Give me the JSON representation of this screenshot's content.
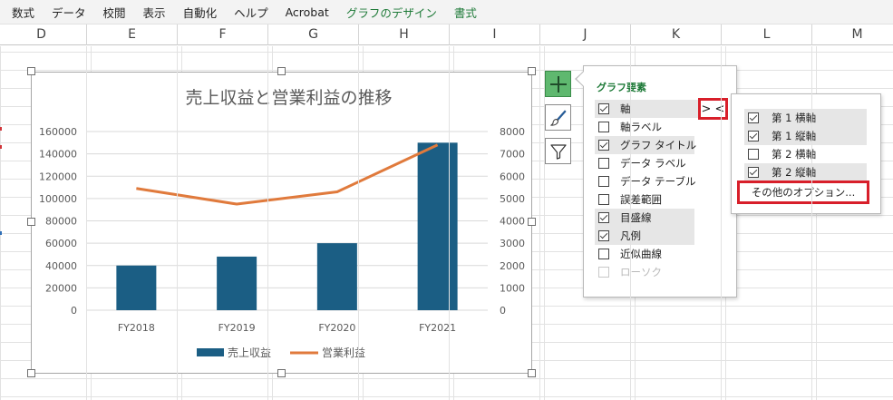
{
  "ribbon": {
    "tabs": [
      {
        "label": "数式",
        "accent": false
      },
      {
        "label": "データ",
        "accent": false
      },
      {
        "label": "校閲",
        "accent": false
      },
      {
        "label": "表示",
        "accent": false
      },
      {
        "label": "自動化",
        "accent": false
      },
      {
        "label": "ヘルプ",
        "accent": false
      },
      {
        "label": "Acrobat",
        "accent": false
      },
      {
        "label": "グラフのデザイン",
        "accent": true
      },
      {
        "label": "書式",
        "accent": true
      }
    ]
  },
  "columns": [
    "D",
    "E",
    "F",
    "G",
    "H",
    "I",
    "J",
    "K",
    "L",
    "M"
  ],
  "chart_data": {
    "type": "bar",
    "title": "売上収益と営業利益の推移",
    "categories": [
      "FY2018",
      "FY2019",
      "FY2020",
      "FY2021"
    ],
    "series": [
      {
        "name": "売上収益",
        "type": "bar",
        "axis": "left",
        "values": [
          40000,
          48000,
          60000,
          150000
        ],
        "color": "#1b5e84"
      },
      {
        "name": "営業利益",
        "type": "line",
        "axis": "right",
        "values": [
          5450,
          4750,
          5300,
          7400
        ],
        "color": "#e07a3c"
      }
    ],
    "y_left": {
      "min": 0,
      "max": 160000,
      "ticks": [
        "0",
        "20000",
        "40000",
        "60000",
        "80000",
        "100000",
        "120000",
        "140000",
        "160000"
      ]
    },
    "y_right": {
      "min": 0,
      "max": 8000,
      "ticks": [
        "0",
        "1000",
        "2000",
        "3000",
        "4000",
        "5000",
        "6000",
        "7000",
        "8000"
      ]
    },
    "grid": true,
    "legend": "bottom"
  },
  "chart_elements_panel": {
    "title": "グラフ要素",
    "items": [
      {
        "label": "軸",
        "checked": true,
        "highlighted": true,
        "disabled": false
      },
      {
        "label": "軸ラベル",
        "checked": false,
        "highlighted": false,
        "disabled": false
      },
      {
        "label": "グラフ タイトル",
        "checked": true,
        "highlighted": true,
        "disabled": false
      },
      {
        "label": "データ ラベル",
        "checked": false,
        "highlighted": false,
        "disabled": false
      },
      {
        "label": "データ テーブル",
        "checked": false,
        "highlighted": false,
        "disabled": false
      },
      {
        "label": "誤差範囲",
        "checked": false,
        "highlighted": false,
        "disabled": false
      },
      {
        "label": "目盛線",
        "checked": true,
        "highlighted": true,
        "disabled": false
      },
      {
        "label": "凡例",
        "checked": true,
        "highlighted": true,
        "disabled": false
      },
      {
        "label": "近似曲線",
        "checked": false,
        "highlighted": false,
        "disabled": false
      },
      {
        "label": "ローソク",
        "checked": false,
        "highlighted": false,
        "disabled": true
      }
    ],
    "expand_label": "> <"
  },
  "axis_submenu": {
    "items": [
      {
        "label": "第 1 横軸",
        "checked": true
      },
      {
        "label": "第 1 縦軸",
        "checked": true
      },
      {
        "label": "第 2 横軸",
        "checked": false
      },
      {
        "label": "第 2 縦軸",
        "checked": true
      }
    ],
    "more_options": "その他のオプション..."
  },
  "colors": {
    "accent_green": "#1e7a38",
    "highlight_red": "#d81f2a"
  },
  "icons": {
    "plus": "plus-icon",
    "brush": "brush-icon",
    "filter": "filter-icon"
  }
}
